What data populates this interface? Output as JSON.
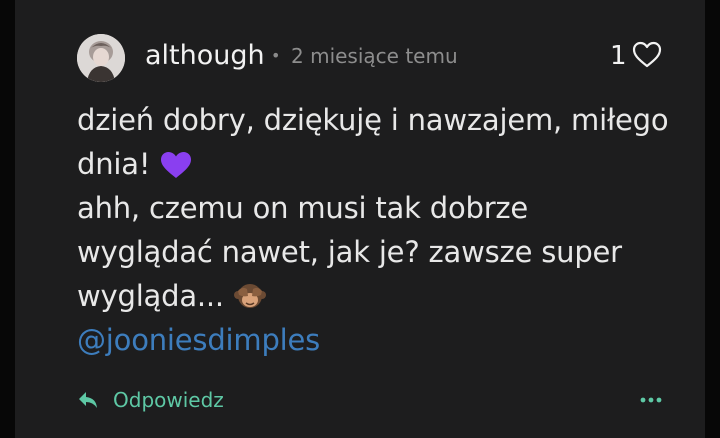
{
  "comment": {
    "author": "although",
    "separator": "•",
    "time_ago": "2 miesiące temu",
    "like_count": "1",
    "body_lines": [
      "dzień dobry, dziękuję i nawzajem, miłego",
      "dnia!",
      "ahh, czemu on musi tak dobrze",
      "wyglądać nawet, jak je? zawsze super",
      "wygląda..."
    ],
    "mention": "@jooniesdimples",
    "reply_label": "Odpowiedz"
  },
  "icons": {
    "like": "heart-outline-icon",
    "reply": "reply-arrow-icon",
    "more": "more-dots-icon",
    "emoji_1": "purple-heart-emoji",
    "emoji_2": "see-no-evil-monkey-emoji"
  },
  "colors": {
    "background": "#1d1d1e",
    "text": "#e8e8e8",
    "muted": "#8d8d8d",
    "mention": "#3d7dbd",
    "accent": "#5ec8a5",
    "purple_heart": "#8a3ff0"
  }
}
